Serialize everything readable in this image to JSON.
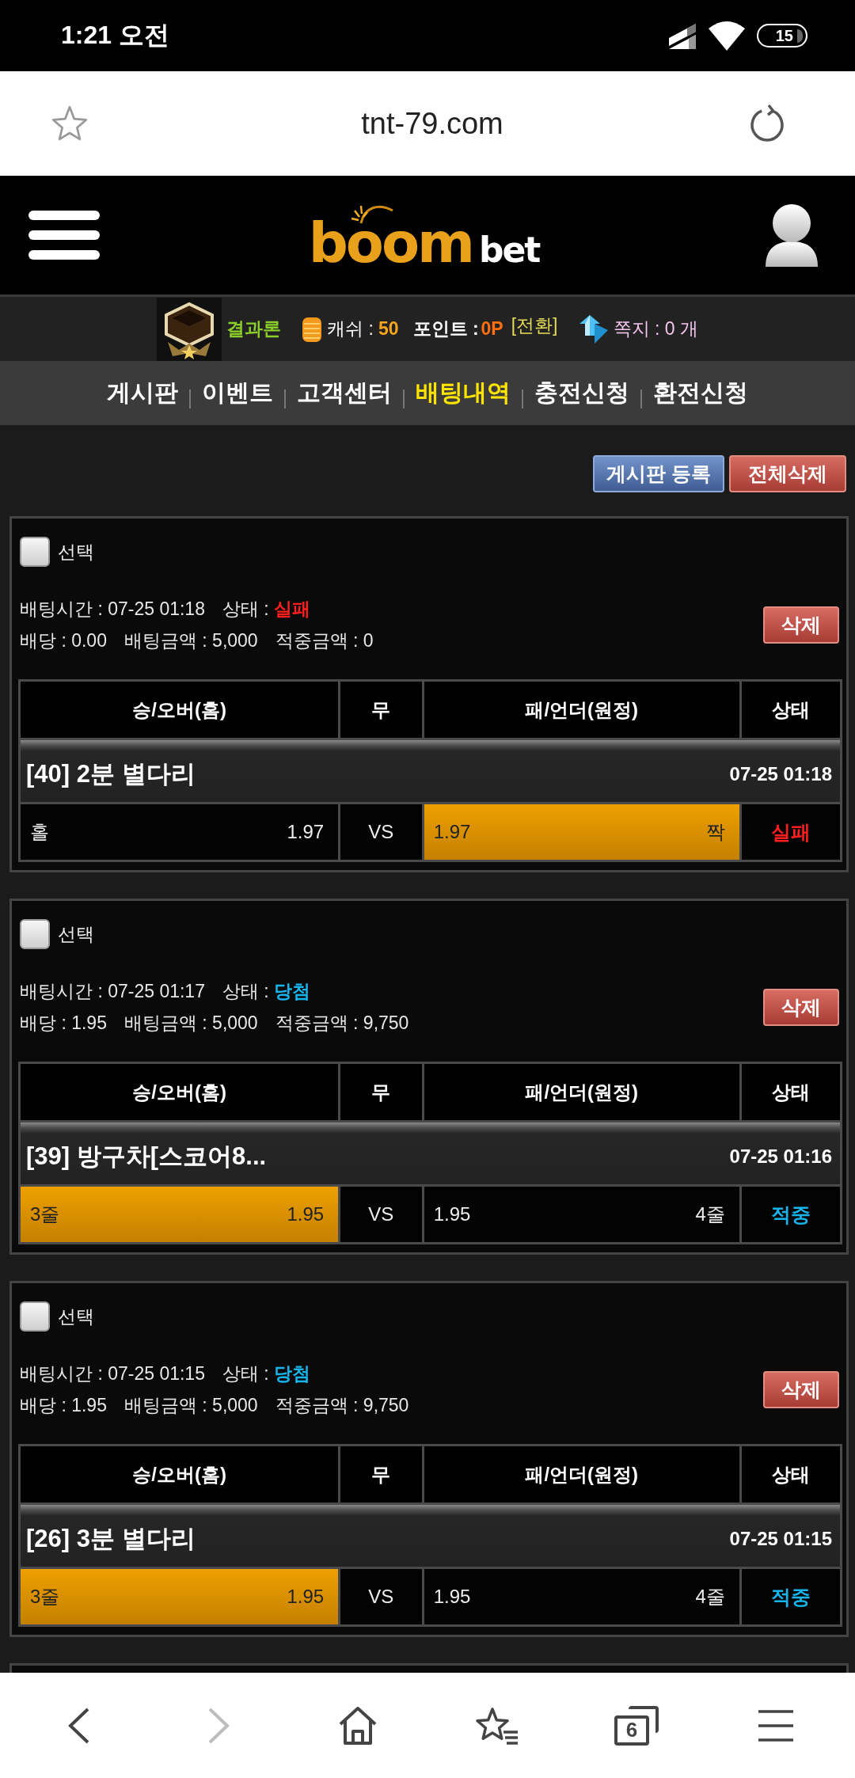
{
  "status_bar": {
    "time": "1:21 오전",
    "battery": "15"
  },
  "address_bar": {
    "url": "tnt-79.com"
  },
  "site_header": {
    "logo": {
      "word": "boom",
      "suffix": "bet"
    }
  },
  "user_bar": {
    "rank": "결과론",
    "cash_label": "캐쉬 :",
    "cash": "50",
    "point_label": "포인트 :",
    "point": "0P",
    "convert_link": "[전환]",
    "messages": "쪽지 : 0 개"
  },
  "nav": [
    {
      "label": "게시판",
      "selected": false
    },
    {
      "label": "이벤트",
      "selected": false
    },
    {
      "label": "고객센터",
      "selected": false
    },
    {
      "label": "배팅내역",
      "selected": true
    },
    {
      "label": "충전신청",
      "selected": false
    },
    {
      "label": "환전신청",
      "selected": false
    }
  ],
  "actions": [
    {
      "label": "게시판 등록",
      "kind": "register"
    },
    {
      "label": "전체삭제",
      "kind": "delete"
    }
  ],
  "bet_list": {
    "more_below": true,
    "items": [
      {
        "checkbox": {
          "label": "선택",
          "checked": false
        },
        "time": "배팅시간 : 07-25 01:18",
        "status_label": "상태 :",
        "status": {
          "text": "실패",
          "kind": "lost"
        },
        "odds": "배당 : 0.00",
        "stake": "배팅금액 : 5,000",
        "payout": "적중금액 : 0",
        "delete": "삭제",
        "columns": [
          "승/오버(홈)",
          "무",
          "패/언더(원정)",
          "상태"
        ],
        "game": {
          "title": "[40] 2분 별다리",
          "time": "07-25 01:18"
        },
        "home": {
          "label": "홀",
          "odds": "1.97",
          "selected": false
        },
        "draw": "VS",
        "away": {
          "odds": "1.97",
          "label": "짝",
          "selected": true
        },
        "result": {
          "text": "실패",
          "kind": "lost"
        }
      },
      {
        "checkbox": {
          "label": "선택",
          "checked": false
        },
        "time": "배팅시간 : 07-25 01:17",
        "status_label": "상태 :",
        "status": {
          "text": "당첨",
          "kind": "won"
        },
        "odds": "배당 : 1.95",
        "stake": "배팅금액 : 5,000",
        "payout": "적중금액 : 9,750",
        "delete": "삭제",
        "columns": [
          "승/오버(홈)",
          "무",
          "패/언더(원정)",
          "상태"
        ],
        "game": {
          "title": "[39] 방구차[스코어8...",
          "time": "07-25 01:16"
        },
        "home": {
          "label": "3줄",
          "odds": "1.95",
          "selected": true
        },
        "draw": "VS",
        "away": {
          "odds": "1.95",
          "label": "4줄",
          "selected": false
        },
        "result": {
          "text": "적중",
          "kind": "won"
        }
      },
      {
        "checkbox": {
          "label": "선택",
          "checked": false
        },
        "time": "배팅시간 : 07-25 01:15",
        "status_label": "상태 :",
        "status": {
          "text": "당첨",
          "kind": "won"
        },
        "odds": "배당 : 1.95",
        "stake": "배팅금액 : 5,000",
        "payout": "적중금액 : 9,750",
        "delete": "삭제",
        "columns": [
          "승/오버(홈)",
          "무",
          "패/언더(원정)",
          "상태"
        ],
        "game": {
          "title": "[26] 3분 별다리",
          "time": "07-25 01:15"
        },
        "home": {
          "label": "3줄",
          "odds": "1.95",
          "selected": true
        },
        "draw": "VS",
        "away": {
          "odds": "1.95",
          "label": "4줄",
          "selected": false
        },
        "result": {
          "text": "적중",
          "kind": "won"
        }
      }
    ]
  },
  "bottom_bar": [
    {
      "kind": "back",
      "disabled": false
    },
    {
      "kind": "forward",
      "disabled": true
    },
    {
      "kind": "home",
      "disabled": false
    },
    {
      "kind": "bookmarks",
      "disabled": false
    },
    {
      "kind": "tabs",
      "count": "6",
      "disabled": false
    },
    {
      "kind": "menu",
      "disabled": false
    }
  ]
}
